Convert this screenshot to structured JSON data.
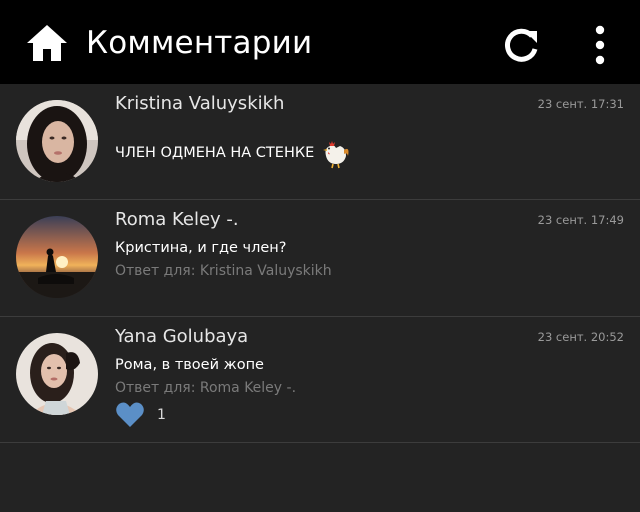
{
  "header": {
    "title": "Комментарии",
    "home_icon": "home-icon",
    "refresh_icon": "refresh-icon",
    "menu_icon": "more-vertical-icon"
  },
  "comments": [
    {
      "author": "Kristina Valuyskikh",
      "time": "23 сент. 17:31",
      "text": "ЧЛЕН ОДМЕНА НА СТЕНКЕ",
      "emoji": "rooster-icon"
    },
    {
      "author": "Roma Keley -.",
      "time": "23 сент. 17:49",
      "text": "Кристина, и где член?",
      "reply": "Ответ для: Kristina Valuyskikh"
    },
    {
      "author": "Yana Golubaya",
      "time": "23 сент. 20:52",
      "text": "Рома, в твоей жопе",
      "reply": "Ответ для: Roma Keley -.",
      "likes": "1",
      "like_icon": "heart-icon"
    }
  ],
  "colors": {
    "topbar": "#000000",
    "background": "#232323",
    "like_heart": "#5b8fc7",
    "meta_text": "#9a9a9a"
  }
}
